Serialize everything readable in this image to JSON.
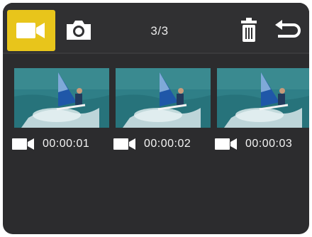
{
  "topbar": {
    "modes": [
      {
        "name": "video",
        "icon": "video-camera-icon",
        "selected": true
      },
      {
        "name": "photo",
        "icon": "camera-icon",
        "selected": false
      }
    ],
    "counter": "3/3",
    "actions": [
      "trash-icon",
      "back-arrow-icon"
    ]
  },
  "thumbnails": [
    {
      "type_icon": "video-camera-icon",
      "duration": "00:00:01"
    },
    {
      "type_icon": "video-camera-icon",
      "duration": "00:00:02"
    },
    {
      "type_icon": "video-camera-icon",
      "duration": "00:00:03"
    }
  ],
  "colors": {
    "accent": "#e8c51b",
    "background": "#2c2c2e",
    "text": "#f4f4f4"
  }
}
